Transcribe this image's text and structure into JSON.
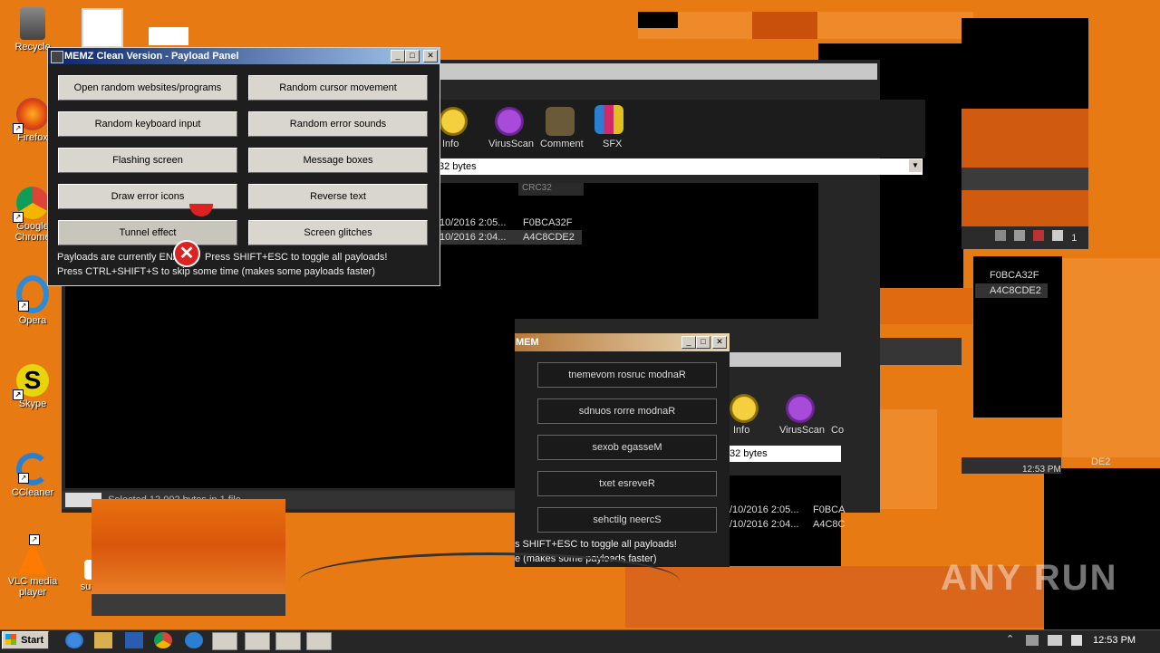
{
  "desktop_icons": [
    {
      "label": "Recycle",
      "icon": "recycle-bin-icon"
    },
    {
      "label": "Firefox",
      "icon": "firefox-icon"
    },
    {
      "label": "Google Chrome",
      "icon": "chrome-icon"
    },
    {
      "label": "Opera",
      "icon": "opera-icon"
    },
    {
      "label": "Skype",
      "icon": "skype-icon"
    },
    {
      "label": "CCleaner",
      "icon": "ccleaner-icon"
    },
    {
      "label": "VLC media player",
      "icon": "vlc-icon"
    },
    {
      "label": "succ",
      "icon": "document-icon"
    }
  ],
  "memz": {
    "title": "MEMZ Clean Version - Payload Panel",
    "buttons": [
      "Open random websites/programs",
      "Random cursor movement",
      "Random keyboard input",
      "Random error sounds",
      "Flashing screen",
      "Message boxes",
      "Draw error icons",
      "Reverse text",
      "Tunnel effect",
      "Screen glitches"
    ],
    "status_line1_a": "Payloads are currently ENA",
    "status_line1_b": "Press SHIFT+ESC to toggle all payloads!",
    "status_line2": "Press CTRL+SHIFT+S to skip some time (makes some payloads faster)",
    "min": "_",
    "max": "□",
    "close": "✕"
  },
  "memz_reversed": {
    "title": "MEM",
    "buttons": [
      "tnemevom rosruc modnaR",
      "sdnuos rorre modnaR",
      "sexob egasseM",
      "txet esreveR",
      "sehctilg neercS"
    ],
    "status_line1": "s SHIFT+ESC to toggle all payloads!",
    "status_line2": "e (makes some payloads faster)"
  },
  "archiver": {
    "toolbar": [
      {
        "label": "Info",
        "icon": "info-icon"
      },
      {
        "label": "VirusScan",
        "icon": "virus-scan-icon"
      },
      {
        "label": "Comment",
        "icon": "comment-icon"
      },
      {
        "label": "SFX",
        "icon": "sfx-icon"
      }
    ],
    "path_value": "32 bytes",
    "col_header": "CRC32",
    "rows": [
      {
        "date": "/10/2016 2:05...",
        "crc": "F0BCA32F"
      },
      {
        "date": "/10/2016 2:04...",
        "crc": "A4C8CDE2"
      }
    ],
    "status": "Selected 12,002 bytes in 1 file"
  },
  "archiver_copy": {
    "toolbar": [
      {
        "label": "Info"
      },
      {
        "label": "VirusScan"
      },
      {
        "label": "Co"
      }
    ],
    "path_value": "32 bytes",
    "rows": [
      {
        "date": "/10/2016 2:05...",
        "crc": "F0BCA"
      },
      {
        "date": "/10/2016 2:04...",
        "crc": "A4C8C"
      }
    ]
  },
  "right_fragments": {
    "crc1": "F0BCA32F",
    "crc2": "A4C8CDE2",
    "crc3": "DE2",
    "clock": "12:53 PM",
    "tray_text": "1"
  },
  "taskbar": {
    "start_label": "Start",
    "clock": "12:53 PM"
  },
  "watermark": "ANY RUN"
}
